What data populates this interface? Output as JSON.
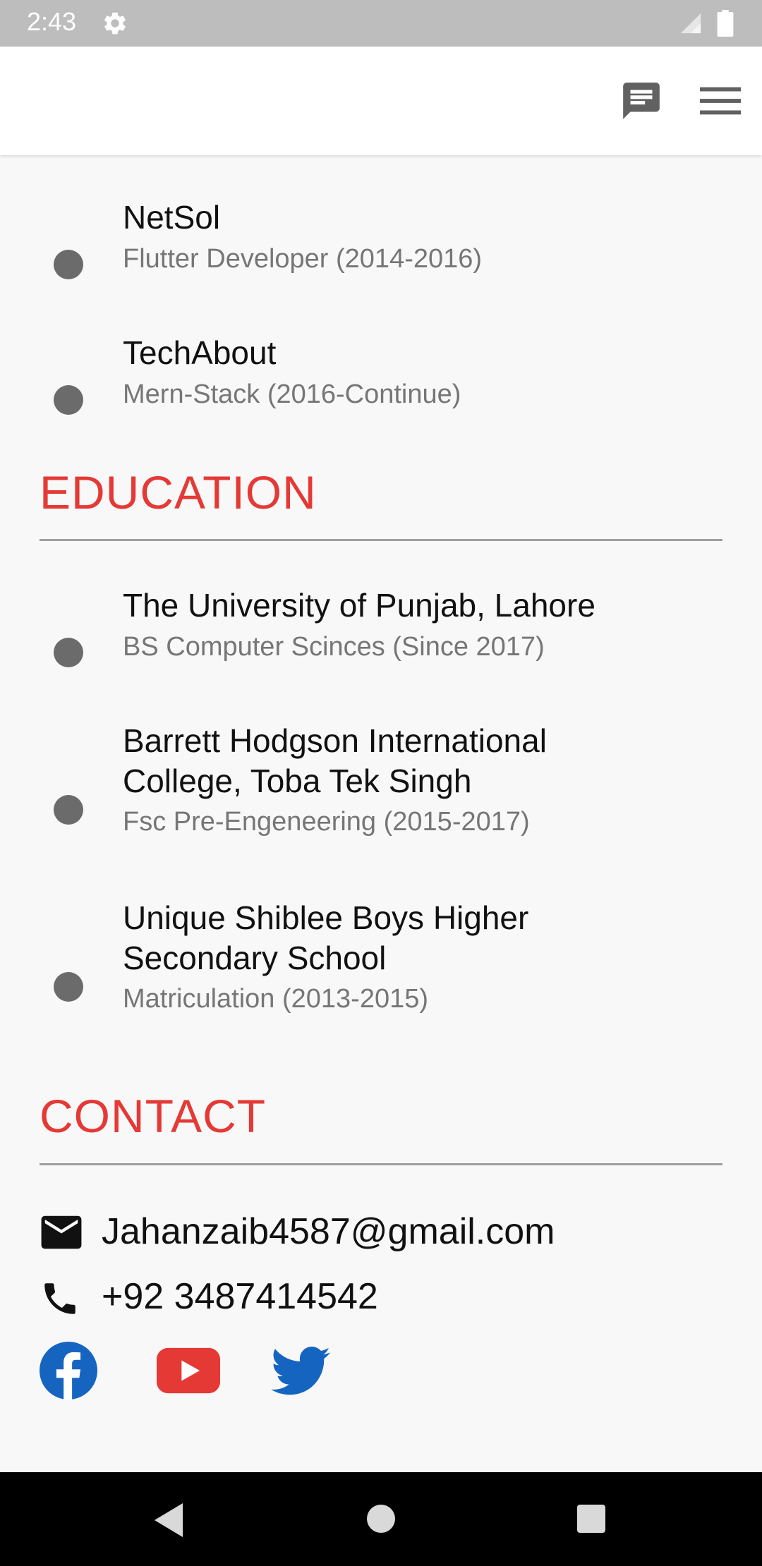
{
  "status_bar": {
    "time": "2:43"
  },
  "experience": {
    "items": [
      {
        "company": "NetSol",
        "detail": "Flutter Developer (2014-2016)"
      },
      {
        "company": "TechAbout",
        "detail": "Mern-Stack (2016-Continue)"
      }
    ]
  },
  "education": {
    "title": "EDUCATION",
    "items": [
      {
        "school": "The University of Punjab, Lahore",
        "detail": "BS Computer Scinces (Since 2017)"
      },
      {
        "school": "Barrett Hodgson International College, Toba Tek Singh",
        "detail": "Fsc Pre-Engeneering (2015-2017)"
      },
      {
        "school": "Unique Shiblee Boys Higher Secondary School",
        "detail": "Matriculation (2013-2015)"
      }
    ]
  },
  "contact": {
    "title": "CONTACT",
    "email": "Jahanzaib4587@gmail.com",
    "phone": "+92 3487414542"
  },
  "icons": {
    "settings": "gear-icon",
    "message": "message-icon",
    "menu": "menu-icon",
    "email": "email-icon",
    "phone": "phone-icon",
    "facebook": "facebook-icon",
    "youtube": "youtube-icon",
    "twitter": "twitter-icon"
  },
  "colors": {
    "accent": "#e53935",
    "bullet": "#6b6b6b",
    "facebook": "#1565c0",
    "youtube": "#e53935",
    "twitter": "#1565c0"
  }
}
